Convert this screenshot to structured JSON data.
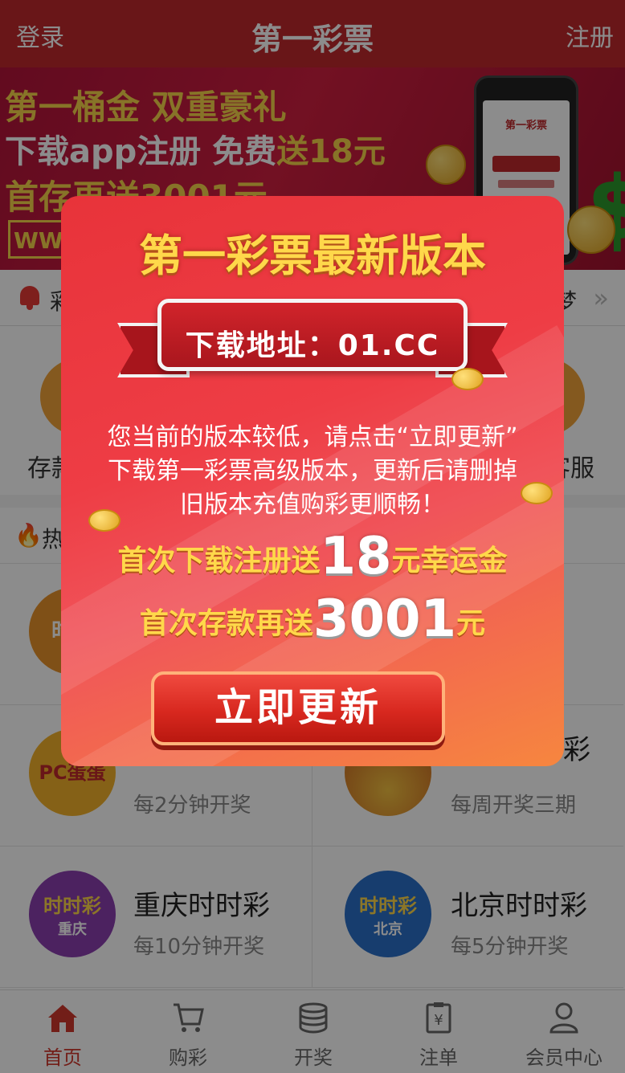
{
  "header": {
    "left": "登录",
    "title": "第一彩票",
    "right": "注册"
  },
  "banner": {
    "line1": "第一桶金  双重豪礼",
    "line2_a": "下载app注册 免费",
    "line2_b": "送18元",
    "line3": "首存再送3001元",
    "url_fragment": "WW",
    "phone_brand": "第一彩票"
  },
  "notice": {
    "text": "彩",
    "tail": "梦"
  },
  "quick": {
    "left_label": "存款",
    "right_label": "客服"
  },
  "hot": {
    "title": "热"
  },
  "lotteries": [
    {
      "name": "",
      "desc": "",
      "icon_text": "时时"
    },
    {
      "name": "",
      "desc": "",
      "icon_text": ""
    },
    {
      "name": "",
      "desc": "每2分钟开奖",
      "icon_text": "PC蛋蛋"
    },
    {
      "name": "彩",
      "desc": "每周开奖三期",
      "icon_text": ""
    },
    {
      "name": "重庆时时彩",
      "desc": "每10分钟开奖",
      "icon_text": "时时彩",
      "icon_sub": "重庆"
    },
    {
      "name": "北京时时彩",
      "desc": "每5分钟开奖",
      "icon_text": "时时彩",
      "icon_sub": "北京"
    }
  ],
  "tabs": [
    {
      "label": "首页",
      "icon": "home-icon"
    },
    {
      "label": "购彩",
      "icon": "cart-icon"
    },
    {
      "label": "开奖",
      "icon": "coins-stack-icon"
    },
    {
      "label": "注单",
      "icon": "clipboard-yen-icon"
    },
    {
      "label": "会员中心",
      "icon": "user-icon"
    }
  ],
  "popup": {
    "title": "第一彩票最新版本",
    "ribbon": "下载地址：01.CC",
    "message_line1": "您当前的版本较低，请点击“立即更新”",
    "message_line2": "下载第一彩票高级版本，更新后请删掉",
    "message_line3": "旧版本充值购彩更顺畅！",
    "promo1_prefix": "首次下载注册送",
    "promo1_amount": "18",
    "promo1_suffix": "元幸运金",
    "promo2_prefix": "首次存款再送",
    "promo2_amount": "3001",
    "promo2_suffix": "元",
    "button": "立即更新"
  },
  "colors": {
    "header": "#c0282c",
    "accent": "#d0372c",
    "gold": "#ffd84a"
  }
}
